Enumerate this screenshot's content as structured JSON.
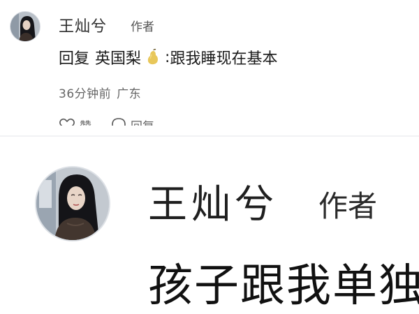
{
  "comment": {
    "author_name": "王灿兮",
    "author_tag": "作者",
    "reply_prefix": "回复",
    "reply_target": "英国梨",
    "reply_target_emoji_icon": "pear-icon",
    "reply_colon": ":",
    "reply_text": "跟我睡现在基本",
    "time": "36分钟前",
    "location": "广东",
    "actions": {
      "like_label": "赞",
      "reply_label": "回复"
    }
  },
  "zoomed": {
    "author_name": "王灿兮",
    "author_tag": "作者",
    "text": "孩子跟我单独"
  },
  "colors": {
    "text_primary": "#1a1a1a",
    "text_secondary": "#666666",
    "divider": "#f1f2f4",
    "pear": "#e8c75a"
  }
}
